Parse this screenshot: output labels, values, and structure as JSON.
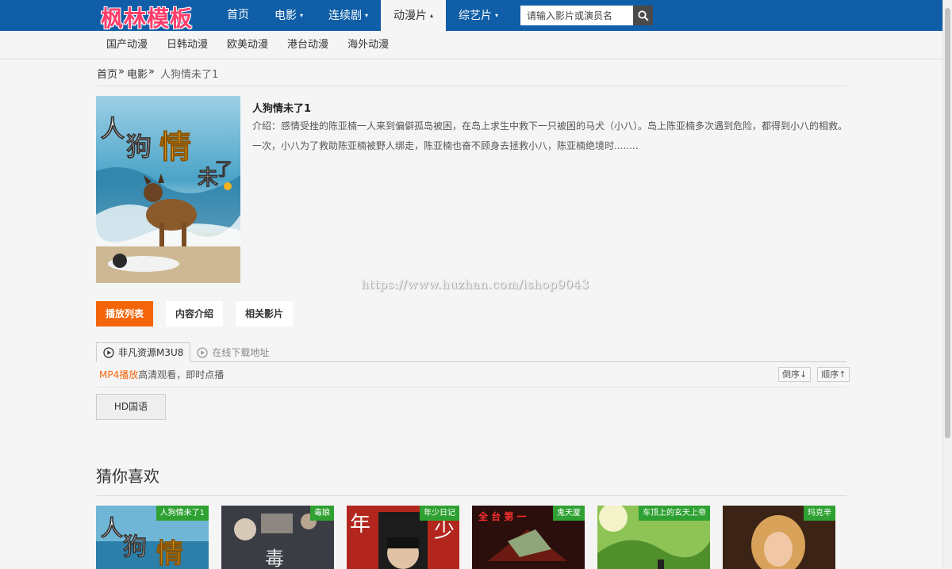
{
  "header": {
    "logo": "枫林模板",
    "nav": [
      {
        "label": "首页",
        "caret": ""
      },
      {
        "label": "电影",
        "caret": "▾"
      },
      {
        "label": "连续剧",
        "caret": "▾"
      },
      {
        "label": "动漫片",
        "caret": "▴"
      },
      {
        "label": "综艺片",
        "caret": "▾"
      }
    ],
    "active_nav": "动漫片",
    "search": {
      "placeholder": "请输入影片或演员名",
      "value": ""
    }
  },
  "subnav": [
    "国产动漫",
    "日韩动漫",
    "欧美动漫",
    "港台动漫",
    "海外动漫"
  ],
  "breadcrumb": {
    "home": "首页",
    "sep1": "»",
    "category": "电影",
    "sep2": "»",
    "current": "人狗情未了1"
  },
  "movie": {
    "title": "人狗情未了1",
    "intro": "介绍：感情受挫的陈亚楠一人来到偏僻孤岛被困，在岛上求生中救下一只被困的马犬（小八）。岛上陈亚楠多次遇到危险，都得到小八的相救。一次，小八为了救助陈亚楠被野人绑走，陈亚楠也奋不顾身去拯救小八，陈亚楠绝境时........",
    "poster_text": "人狗情未了"
  },
  "watermark": "https://www.huzhan.com/ishop9043",
  "tabs": [
    "播放列表",
    "内容介绍",
    "相关影片"
  ],
  "sources": {
    "active": "非凡资源M3U8",
    "other": "在线下载地址",
    "info_highlight": "MP4播放",
    "info_rest": "高清观看，即时点播",
    "sort_desc": "倒序↓",
    "sort_asc": "顺序↑",
    "episodes": [
      "HD国语"
    ]
  },
  "recommend": {
    "title": "猜你喜欢",
    "items": [
      {
        "tag": "人狗情未了1"
      },
      {
        "tag": "毒娘"
      },
      {
        "tag": "年少日记"
      },
      {
        "tag": "鬼天厦"
      },
      {
        "tag": "车顶上的玄天上帝"
      },
      {
        "tag": "玛克辛"
      }
    ]
  },
  "colors": {
    "header": "#0f5ea7",
    "accent": "#f4650a",
    "tag": "#2fa132",
    "logo": "#ff3d6a"
  }
}
